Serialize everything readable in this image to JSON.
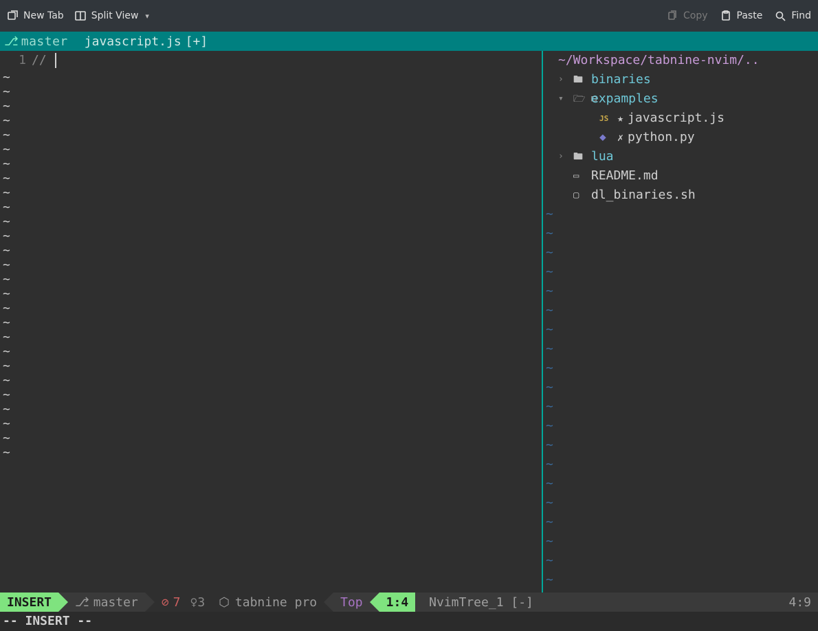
{
  "menubar": {
    "new_tab": "New Tab",
    "split_view": "Split View",
    "copy": "Copy",
    "paste": "Paste",
    "find": "Find"
  },
  "tabline": {
    "branch": "master",
    "filename": "javascript.js",
    "modified": "[+]"
  },
  "editor": {
    "line_number": "1",
    "content": "// "
  },
  "tree": {
    "root": "~/Workspace/tabnine-nvim/..",
    "items": [
      {
        "type": "dir",
        "open": false,
        "depth": 1,
        "name": "binaries"
      },
      {
        "type": "dir",
        "open": true,
        "depth": 1,
        "name": "expamples"
      },
      {
        "type": "file",
        "depth": 2,
        "icon": "js",
        "mark": "★",
        "name": "javascript.js"
      },
      {
        "type": "file",
        "depth": 2,
        "icon": "py",
        "mark": "✗",
        "name": "python.py"
      },
      {
        "type": "dir",
        "open": false,
        "depth": 1,
        "name": "lua"
      },
      {
        "type": "file",
        "depth": 1,
        "icon": "md",
        "mark": "",
        "name": "README.md"
      },
      {
        "type": "file",
        "depth": 1,
        "icon": "sh",
        "mark": "",
        "name": "dl_binaries.sh"
      }
    ]
  },
  "status": {
    "mode": "INSERT",
    "branch": "master",
    "diag_err": "7",
    "diag_hint": "3",
    "tabnine": "tabnine pro",
    "scroll": "Top",
    "pos_left": "1:4",
    "tree_title": "NvimTree_1 [-]",
    "pos_right": "4:9"
  },
  "cmdline": "-- INSERT --"
}
